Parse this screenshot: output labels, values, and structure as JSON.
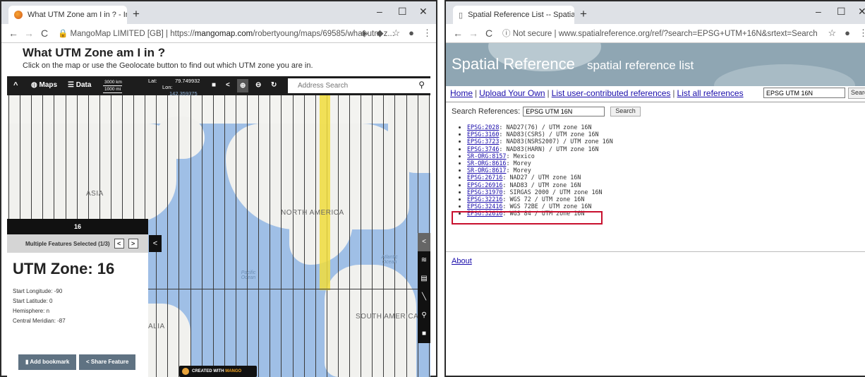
{
  "left_window": {
    "tab_title": "What UTM Zone am I in ? - Intern",
    "tab_close": "×",
    "new_tab": "+",
    "window_controls": [
      "–",
      "☐",
      "✕"
    ],
    "nav": {
      "back": "←",
      "forward": "→",
      "reload": "C"
    },
    "url_origin": "MangoMap LIMITED [GB]",
    "url_sep": "|",
    "url_scheme": "https://",
    "url_host": "mangomap.com",
    "url_path": "/robertyoung/maps/69585/what-utm-z...",
    "page_title": "What UTM Zone am I in ?",
    "page_subtitle": "Click on the map or use the Geolocate button to find out which UTM zone you are in.",
    "toolbar": {
      "collapse": "^",
      "maps_label": "Maps",
      "data_label": "Data",
      "scale_km": "3000 km",
      "scale_mi": "1000 mi",
      "lat_label": "Lat:",
      "lat_value": "79.749932",
      "lon_label": "Lon:",
      "lon_value": "142.359375",
      "search_placeholder": "Address Search"
    },
    "map": {
      "labels": [
        "ASIA",
        "NORTH AMERICA",
        "SOUTH AMERICA",
        "ALIA"
      ],
      "ocean_labels": [
        "Pacific Ocean",
        "Atlantic Ocean"
      ],
      "zone_bar_number": "16",
      "colors": {
        "ocean": "#9fbfe6",
        "land": "#f1f1ee",
        "highlight": "#f0dc3c"
      }
    },
    "panel": {
      "header": "Multiple Features Selected (1/3)",
      "prev": "<",
      "next": ">",
      "title": "UTM Zone: 16",
      "properties": [
        "Start Longitude: -90",
        "Start Latitude: 0",
        "Hemisphere: n",
        "Central Meridian: -87"
      ],
      "add_bookmark": "Add bookmark",
      "share_feature": "Share Feature",
      "collapse": "<"
    },
    "right_tools": [
      "<",
      "≋",
      "▤",
      "╲",
      "⚲",
      "■"
    ],
    "brand_prefix": "CREATED WITH ",
    "brand_name": "MANGO"
  },
  "right_window": {
    "tab_title": "Spatial Reference List -- Spatial R",
    "tab_close": "×",
    "new_tab": "+",
    "window_controls": [
      "–",
      "☐",
      "✕"
    ],
    "nav": {
      "back": "←",
      "forward": "→",
      "reload": "C"
    },
    "security": "Not secure",
    "url_sep": "|",
    "url": "www.spatialreference.org/ref/?search=EPSG+UTM+16N&srtext=Search",
    "site_title": "Spatial Reference",
    "site_subtitle": "spatial reference list",
    "nav_links": [
      "Home",
      "Upload Your Own",
      "List user-contributed references",
      "List all references"
    ],
    "nav_search_value": "EPSG UTM 16N",
    "nav_search_button": "Search",
    "search_label": "Search References:",
    "search_value": "EPSG UTM 16N",
    "search_button": "Search",
    "results": [
      {
        "code": "EPSG:2028",
        "name": ": NAD27(76) / UTM zone 16N"
      },
      {
        "code": "EPSG:3160",
        "name": ": NAD83(CSRS) / UTM zone 16N"
      },
      {
        "code": "EPSG:3723",
        "name": ": NAD83(NSRS2007) / UTM zone 16N"
      },
      {
        "code": "EPSG:3746",
        "name": ": NAD83(HARN) / UTM zone 16N"
      },
      {
        "code": "SR-ORG:8157",
        "name": ": Mexico"
      },
      {
        "code": "SR-ORG:8616",
        "name": ": Morey"
      },
      {
        "code": "SR-ORG:8617",
        "name": ": Morey"
      },
      {
        "code": "EPSG:26716",
        "name": ": NAD27 / UTM zone 16N"
      },
      {
        "code": "EPSG:26916",
        "name": ": NAD83 / UTM zone 16N"
      },
      {
        "code": "EPSG:31970",
        "name": ": SIRGAS 2000 / UTM zone 16N"
      },
      {
        "code": "EPSG:32216",
        "name": ": WGS 72 / UTM zone 16N"
      },
      {
        "code": "EPSG:32416",
        "name": ": WGS 72BE / UTM zone 16N"
      },
      {
        "code": "EPSG:32616",
        "name": ": WGS 84 / UTM zone 16N"
      }
    ],
    "about_link": "About",
    "highlight_color": "#c8102e"
  }
}
